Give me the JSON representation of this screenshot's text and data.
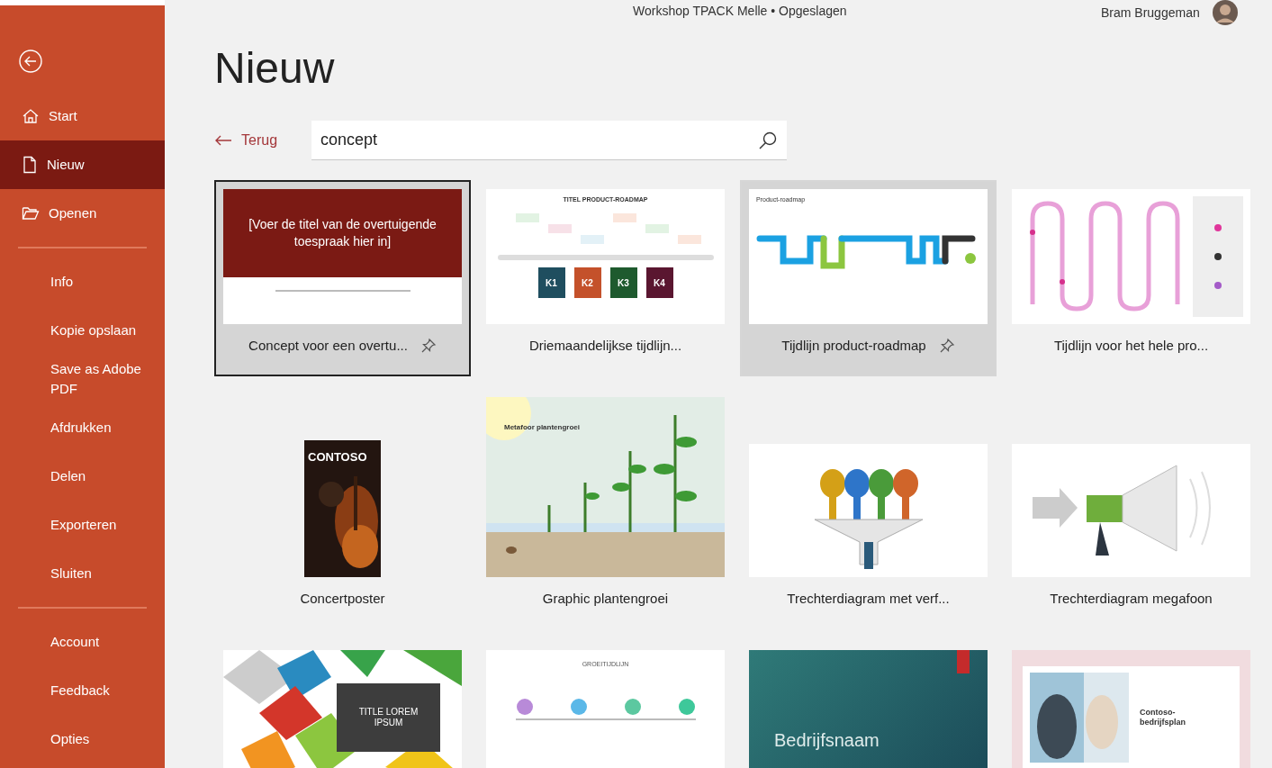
{
  "title_bar": {
    "document": "Workshop TPACK Melle • Opgeslagen",
    "user": "Bram Bruggeman"
  },
  "sidebar": {
    "groups": [
      [
        {
          "label": "Start",
          "selected": false
        },
        {
          "label": "Nieuw",
          "selected": true
        },
        {
          "label": "Openen",
          "selected": false
        }
      ],
      [
        {
          "label": "Info",
          "selected": false
        },
        {
          "label": "Kopie opslaan",
          "selected": false
        },
        {
          "label": "Save as Adobe PDF",
          "selected": false
        },
        {
          "label": "Afdrukken",
          "selected": false
        },
        {
          "label": "Delen",
          "selected": false
        },
        {
          "label": "Exporteren",
          "selected": false
        },
        {
          "label": "Sluiten",
          "selected": false
        }
      ],
      [
        {
          "label": "Account",
          "selected": false
        },
        {
          "label": "Feedback",
          "selected": false
        },
        {
          "label": "Opties",
          "selected": false
        }
      ]
    ]
  },
  "page_title": "Nieuw",
  "back_link": "Terug",
  "search": {
    "value": "concept"
  },
  "template_rows": [
    [
      {
        "kind": "speech",
        "title": "Concept voor een overtu...",
        "selected": true,
        "hovered": false,
        "texts": [
          "[Voer de titel van de overtuigende toespraak hier in]"
        ]
      },
      {
        "kind": "roadmap_quarters",
        "title": "Driemaandelijkse tijdlijn...",
        "selected": false,
        "hovered": false,
        "texts": [
          "TITEL PRODUCT-ROADMAP"
        ],
        "tags": [
          {
            "label": "K1",
            "color": "#1f4e5f"
          },
          {
            "label": "K2",
            "color": "#c4512b"
          },
          {
            "label": "K3",
            "color": "#1e5a2e"
          },
          {
            "label": "K4",
            "color": "#5a1630"
          }
        ]
      },
      {
        "kind": "roadmap_product",
        "title": "Tijdlijn product-roadmap",
        "selected": false,
        "hovered": true,
        "texts": [
          "Product-roadmap"
        ]
      },
      {
        "kind": "timeline_pink",
        "title": "Tijdlijn voor het hele pro...",
        "selected": false,
        "hovered": false
      }
    ],
    [
      {
        "kind": "poster",
        "title": "Concertposter",
        "selected": false,
        "hovered": false,
        "texts": [
          "CONTOSO"
        ]
      },
      {
        "kind": "plant",
        "title": "Graphic plantengroei",
        "selected": false,
        "hovered": false,
        "texts": [
          "Metafoor plantengroei"
        ]
      },
      {
        "kind": "funnel",
        "title": "Trechterdiagram met verf...",
        "selected": false,
        "hovered": false
      },
      {
        "kind": "megaphone",
        "title": "Trechterdiagram megafoon",
        "selected": false,
        "hovered": false
      }
    ],
    [
      {
        "kind": "cubes",
        "selected": false,
        "hovered": false,
        "texts": [
          "TITLE LOREM IPSUM"
        ]
      },
      {
        "kind": "growth",
        "selected": false,
        "hovered": false,
        "texts": [
          "GROEITIJDLIJN"
        ]
      },
      {
        "kind": "company",
        "selected": false,
        "hovered": false,
        "texts": [
          "Bedrijfsnaam"
        ]
      },
      {
        "kind": "bizplan",
        "selected": false,
        "hovered": false,
        "texts": [
          "Contoso-bedrijfsplan"
        ]
      }
    ]
  ]
}
